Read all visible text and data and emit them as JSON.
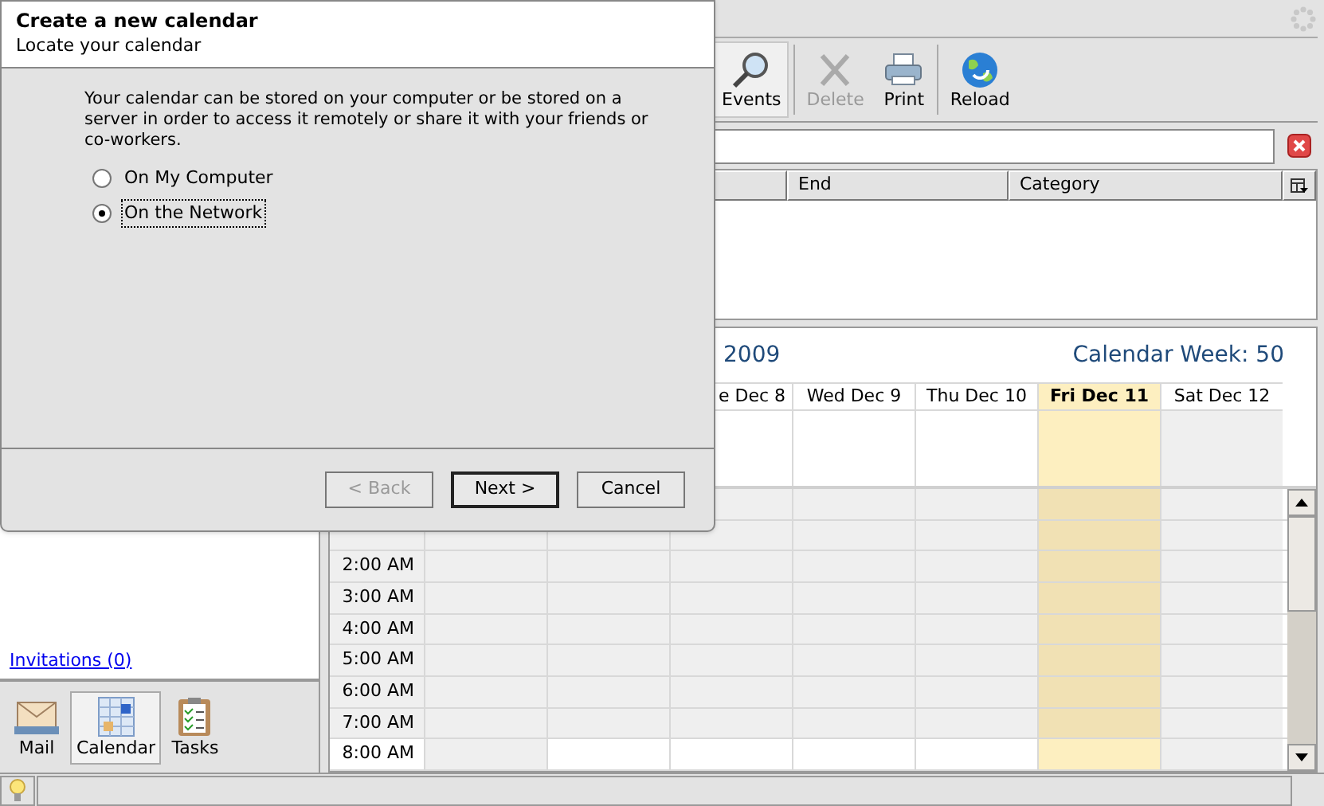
{
  "toolbar": {
    "buttons": [
      {
        "label": "Events",
        "pressed": true,
        "disabled": false
      },
      {
        "label": "Delete",
        "pressed": false,
        "disabled": true
      },
      {
        "label": "Print",
        "pressed": false,
        "disabled": false
      },
      {
        "label": "Reload",
        "pressed": false,
        "disabled": false
      }
    ]
  },
  "event_list": {
    "columns": [
      {
        "label": "End"
      },
      {
        "label": "Category"
      }
    ]
  },
  "calendar": {
    "title": "2009",
    "week": "Calendar Week: 50",
    "days": [
      {
        "label": "e Dec 8",
        "today": false
      },
      {
        "label": "Wed Dec 9",
        "today": false
      },
      {
        "label": "Thu Dec 10",
        "today": false
      },
      {
        "label": "Fri Dec 11",
        "today": true
      },
      {
        "label": "Sat Dec 12",
        "today": false
      }
    ],
    "hours": [
      {
        "label": "2:00 AM",
        "work_hours": false
      },
      {
        "label": "3:00 AM",
        "work_hours": false
      },
      {
        "label": "4:00 AM",
        "work_hours": false
      },
      {
        "label": "5:00 AM",
        "work_hours": false
      },
      {
        "label": "6:00 AM",
        "work_hours": false
      },
      {
        "label": "7:00 AM",
        "work_hours": false
      },
      {
        "label": "8:00 AM",
        "work_hours": true
      }
    ]
  },
  "sidebar": {
    "link": "Invitations (0)",
    "nav": [
      {
        "label": "Mail",
        "selected": false
      },
      {
        "label": "Calendar",
        "selected": true
      },
      {
        "label": "Tasks",
        "selected": false
      }
    ]
  },
  "dialog": {
    "title": "Create a new calendar",
    "subtitle": "Locate your calendar",
    "description": "Your calendar can be stored on your computer or be stored on a server in order to access it remotely or share it with your friends or co-workers.",
    "options": [
      {
        "label": "On My Computer",
        "selected": false
      },
      {
        "label": "On the Network",
        "selected": true
      }
    ],
    "buttons": [
      {
        "label": "< Back",
        "disabled": true,
        "default": false
      },
      {
        "label": "Next >",
        "disabled": false,
        "default": true
      },
      {
        "label": "Cancel",
        "disabled": false,
        "default": false
      }
    ]
  }
}
